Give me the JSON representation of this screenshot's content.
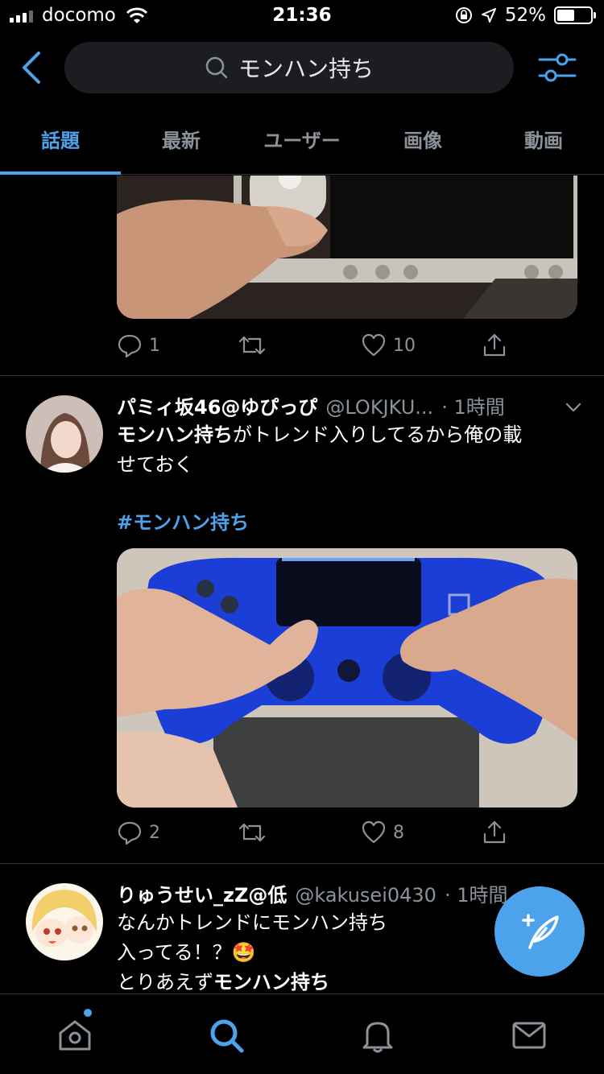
{
  "status": {
    "carrier": "docomo",
    "time": "21:36",
    "battery_text": "52%",
    "battery_level": 0.52
  },
  "search": {
    "query": "モンハン持ち"
  },
  "tabs": [
    "話題",
    "最新",
    "ユーザー",
    "画像",
    "動画"
  ],
  "active_tab_index": 0,
  "tweets": [
    {
      "reply_count": "1",
      "retweet_count": "",
      "like_count": "10"
    },
    {
      "name": "パミィ坂46@ゆぴっぴ",
      "handle": "@LOKJKU...",
      "time": "· 1時間",
      "text_bold": "モンハン持ち",
      "text_rest_1": "がトレンド入りしてるから俺の載",
      "text_line_2": "せておく",
      "hashtag": "#モンハン持ち",
      "reply_count": "2",
      "retweet_count": "",
      "like_count": "8"
    },
    {
      "name": "りゅうせい_zZ@低",
      "handle": "@kakusei0430",
      "time": "· 1時間",
      "line_1": "なんかトレンドにモンハン持ち",
      "line_2": "入ってる！？",
      "emoji": "🤩",
      "line_3_prefix": "とりあえず",
      "line_3_bold": "モンハン持ち"
    }
  ],
  "colors": {
    "accent": "#4da3eb",
    "muted": "#8b9299",
    "background": "#000000",
    "search_bg": "#1c1d21"
  },
  "icons": {
    "back": "chevron-left-icon",
    "search": "search-icon",
    "filter": "sliders-icon",
    "reply": "reply-icon",
    "retweet": "retweet-icon",
    "like": "heart-icon",
    "share": "share-icon",
    "compose": "compose-icon",
    "home": "home-icon",
    "explore": "search-icon",
    "notifications": "bell-icon",
    "messages": "mail-icon"
  }
}
